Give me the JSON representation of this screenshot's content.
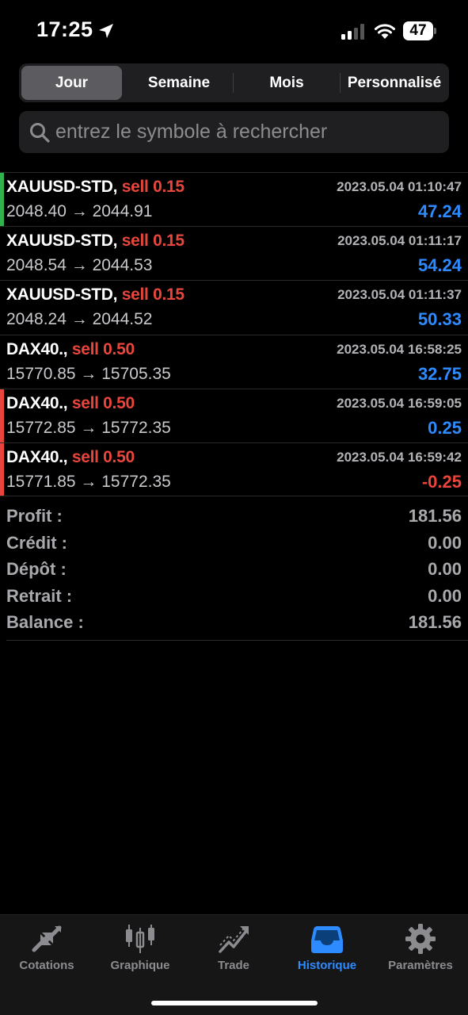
{
  "status_bar": {
    "time": "17:25",
    "battery": "47"
  },
  "period_tabs": [
    {
      "label": "Jour",
      "active": true
    },
    {
      "label": "Semaine",
      "active": false
    },
    {
      "label": "Mois",
      "active": false
    },
    {
      "label": "Personnalisé",
      "active": false
    }
  ],
  "search": {
    "placeholder": "entrez le symbole à rechercher",
    "value": ""
  },
  "trades": [
    {
      "symbol": "XAUUSD-STD,",
      "type": "sell 0.15",
      "date": "2023.05.04 01:10:47",
      "prices": "2048.40 → 2044.91",
      "profit": "47.24",
      "accent": "#2fb34a"
    },
    {
      "symbol": "XAUUSD-STD,",
      "type": "sell 0.15",
      "date": "2023.05.04 01:11:17",
      "prices": "2048.54 → 2044.53",
      "profit": "54.24",
      "accent": ""
    },
    {
      "symbol": "XAUUSD-STD,",
      "type": "sell 0.15",
      "date": "2023.05.04 01:11:37",
      "prices": "2048.24 → 2044.52",
      "profit": "50.33",
      "accent": ""
    },
    {
      "symbol": "DAX40.,",
      "type": "sell 0.50",
      "date": "2023.05.04 16:58:25",
      "prices": "15770.85 → 15705.35",
      "profit": "32.75",
      "accent": ""
    },
    {
      "symbol": "DAX40.,",
      "type": "sell 0.50",
      "date": "2023.05.04 16:59:05",
      "prices": "15772.85 → 15772.35",
      "profit": "0.25",
      "accent": "#e8463c"
    },
    {
      "symbol": "DAX40.,",
      "type": "sell 0.50",
      "date": "2023.05.04 16:59:42",
      "prices": "15771.85 → 15772.35",
      "profit": "-0.25",
      "accent": "#e8463c"
    }
  ],
  "summary": [
    {
      "label": "Profit :",
      "value": "181.56"
    },
    {
      "label": "Crédit :",
      "value": "0.00"
    },
    {
      "label": "Dépôt :",
      "value": "0.00"
    },
    {
      "label": "Retrait :",
      "value": "0.00"
    },
    {
      "label": "Balance :",
      "value": "181.56"
    }
  ],
  "tabbar": [
    {
      "label": "Cotations",
      "icon": "quotes-arrows-icon",
      "active": false
    },
    {
      "label": "Graphique",
      "icon": "candlestick-chart-icon",
      "active": false
    },
    {
      "label": "Trade",
      "icon": "trend-line-icon",
      "active": false
    },
    {
      "label": "Historique",
      "icon": "inbox-tray-icon",
      "active": true
    },
    {
      "label": "Paramètres",
      "icon": "gear-icon",
      "active": false
    }
  ],
  "colors": {
    "accent_blue": "#2e8bff",
    "sell_red": "#e8463c",
    "buy_green": "#2fb34a"
  }
}
